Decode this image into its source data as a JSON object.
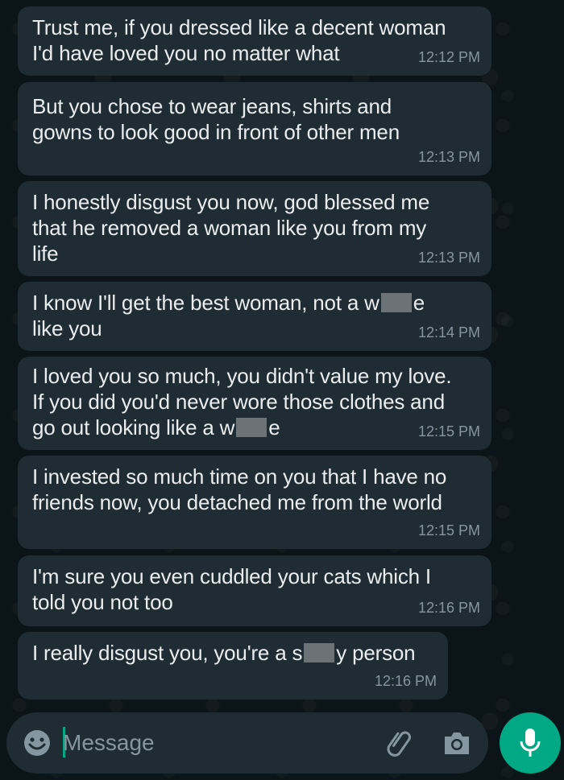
{
  "messages": [
    {
      "text": "Trust me, if you dressed like a decent woman\nI'd have loved you no matter what",
      "time": "12:12 PM"
    },
    {
      "text": "But you chose to wear jeans, shirts and\ngowns to look good in front of other men",
      "time": "12:13 PM"
    },
    {
      "text": "I honestly disgust you now, god blessed me\nthat he removed a woman like you from my\nlife",
      "time": "12:13 PM"
    },
    {
      "pre": "I know I'll get the best woman, not a w",
      "post": "e\nlike you",
      "time": "12:14 PM"
    },
    {
      "pre": "I loved you so much, you didn't value my love.\nIf you did you'd never wore those clothes and\ngo out looking like a w",
      "post": "e",
      "time": "12:15 PM"
    },
    {
      "text": "I invested so much time on you that I have no\nfriends now, you detached me from the world",
      "time": "12:15 PM"
    },
    {
      "text": "I'm sure you even cuddled your cats which I\ntold you not too",
      "time": "12:16 PM"
    },
    {
      "pre": "I really disgust you, you're a s",
      "post": "y person",
      "time": "12:16 PM"
    }
  ],
  "input": {
    "placeholder": "Message"
  },
  "icons": {
    "emoji": "emoji-icon",
    "attach": "paperclip-icon",
    "camera": "camera-icon",
    "mic": "microphone-icon"
  },
  "colors": {
    "bubble": "#1f2c33",
    "background": "#0b1418",
    "accent": "#00a884",
    "text": "#e9edef",
    "meta": "#8696a0"
  }
}
